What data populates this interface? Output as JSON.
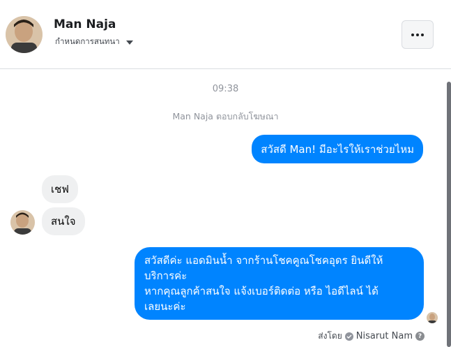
{
  "header": {
    "name": "Man Naja",
    "subtitle": "กำหนดการสนทนา",
    "more_label": "..."
  },
  "conversation": {
    "time": "09:38",
    "context_note": "Man Naja ตอบกลับโฆษณา",
    "messages": [
      {
        "from": "page",
        "text": "สวัสดี Man! มีอะไรให้เราช่วยไหม"
      },
      {
        "from": "user",
        "text": "เชฟ"
      },
      {
        "from": "user",
        "text": "สนใจ"
      },
      {
        "from": "page",
        "lines": [
          "สวัสดีค่ะ แอดมินน้ำ จากร้านโชคคูณโชคอุดร ยินดีให้",
          "บริการค่ะ",
          "หากคุณลูกค้าสนใจ แจ้งเบอร์ติดต่อ หรือ ไอดีไลน์ ได้",
          "เลยนะค่ะ"
        ]
      }
    ],
    "sent_by_label": "ส่งโดย",
    "sent_by_name": "Nisarut Nam"
  },
  "colors": {
    "outgoing_bubble": "#0084ff",
    "incoming_bubble": "#eff0f1"
  }
}
